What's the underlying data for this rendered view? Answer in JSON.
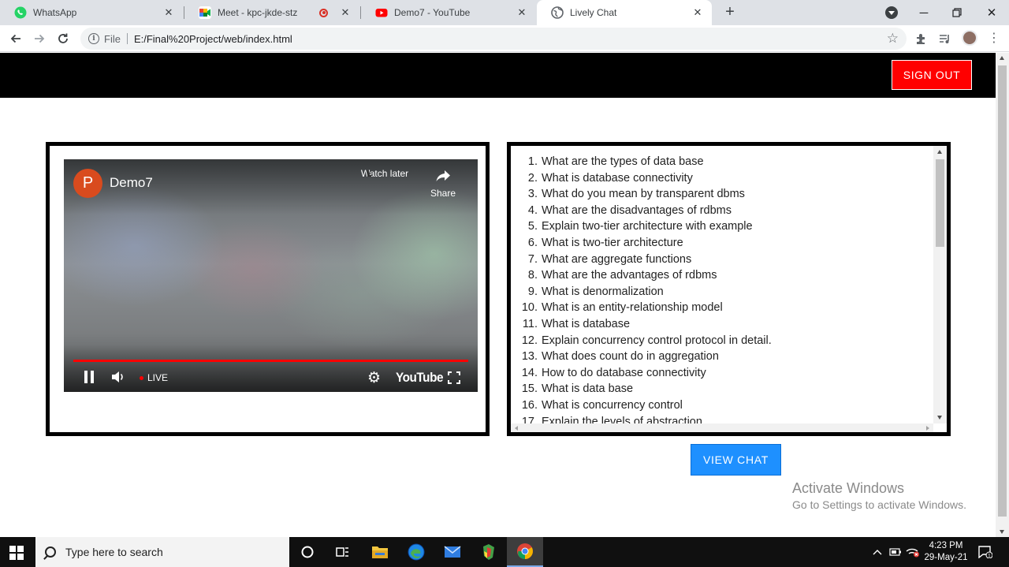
{
  "browser": {
    "tabs": [
      {
        "title": "WhatsApp",
        "icon": "whatsapp-icon",
        "active": false
      },
      {
        "title": "Meet - kpc-jkde-stz",
        "icon": "google-meet-icon",
        "active": false
      },
      {
        "title": "Demo7 - YouTube",
        "icon": "youtube-icon",
        "active": false
      },
      {
        "title": "Lively Chat",
        "icon": "globe-icon",
        "active": true
      }
    ],
    "address": {
      "scheme_label": "File",
      "url": "E:/Final%20Project/web/index.html"
    }
  },
  "header": {
    "signout_label": "SIGN OUT",
    "signout_color": "#ff0000"
  },
  "video": {
    "channel_initial": "P",
    "title": "Demo7",
    "watch_later_label": "Watch later",
    "share_label": "Share",
    "live_label": "LIVE",
    "logo_text": "YouTube"
  },
  "questions": [
    {
      "num": "1.",
      "text": "What are the types of data base"
    },
    {
      "num": "2.",
      "text": "What is database connectivity"
    },
    {
      "num": "3.",
      "text": "What do you mean by transparent dbms"
    },
    {
      "num": "4.",
      "text": "What are the disadvantages of rdbms"
    },
    {
      "num": "5.",
      "text": "Explain two-tier architecture with example"
    },
    {
      "num": "6.",
      "text": "What is two-tier architecture"
    },
    {
      "num": "7.",
      "text": "What are aggregate functions"
    },
    {
      "num": "8.",
      "text": "What are the advantages of rdbms"
    },
    {
      "num": "9.",
      "text": "What is denormalization"
    },
    {
      "num": "10.",
      "text": "What is an entity-relationship model"
    },
    {
      "num": "11.",
      "text": "What is database"
    },
    {
      "num": "12.",
      "text": "Explain concurrency control protocol in detail."
    },
    {
      "num": "13.",
      "text": "What does count do in aggregation"
    },
    {
      "num": "14.",
      "text": "How to do database connectivity"
    },
    {
      "num": "15.",
      "text": "What is data base"
    },
    {
      "num": "16.",
      "text": "What is concurrency control"
    },
    {
      "num": "17.",
      "text": "Explain the levels of abstraction"
    }
  ],
  "view_chat_label": "VIEW CHAT",
  "view_chat_color": "#1e90ff",
  "watermark": {
    "title": "Activate Windows",
    "subtitle": "Go to Settings to activate Windows."
  },
  "taskbar": {
    "search_placeholder": "Type here to search",
    "time": "4:23 PM",
    "date": "29-May-21"
  }
}
